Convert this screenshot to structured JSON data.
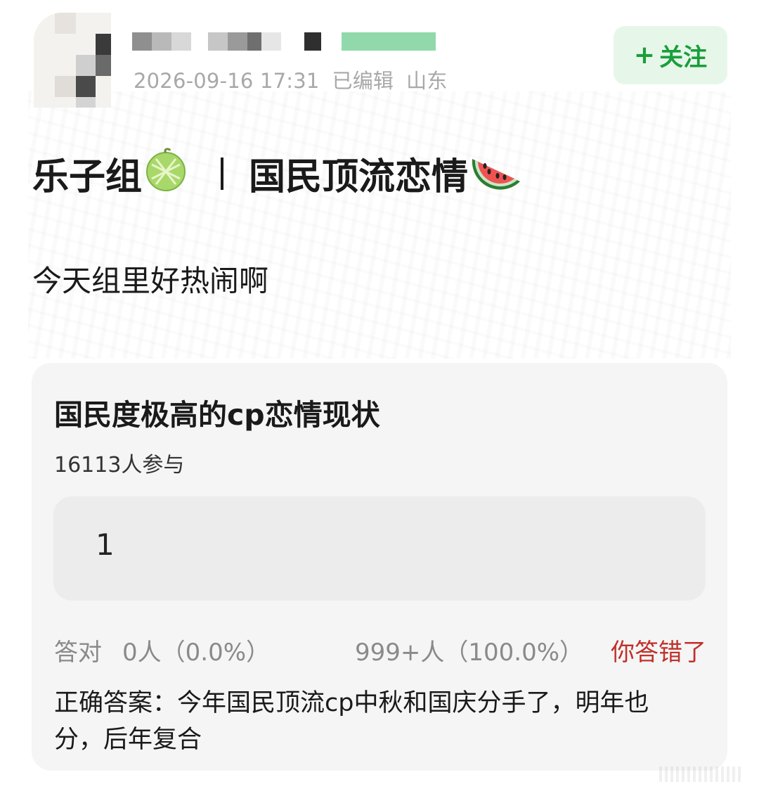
{
  "post": {
    "timestamp": "2026-09-16 17:31",
    "edited": "已编辑",
    "location": "山东",
    "follow_label": "关注",
    "follow_plus": "+",
    "title_left": "乐子组",
    "title_right": "国民顶流恋情",
    "body": "今天组里好热闹啊"
  },
  "quiz": {
    "title": "国民度极高的cp恋情现状",
    "participants": "16113人参与",
    "answer_value": "1",
    "correct_label": "答对",
    "correct_stats": "0人（0.0%）",
    "wrong_stats": "999+人（100.0%）",
    "wrong_message": "你答错了",
    "correct_answer": "正确答案：今年国民顶流cp中秋和国庆分手了，明年也分，后年复合"
  },
  "icons": {
    "title_left_icon": "melon-icon",
    "title_right_icon": "watermelon-icon"
  },
  "colors": {
    "accent_green": "#1a9e3b",
    "follow_bg": "#e6f7ea",
    "wrong_red": "#c0302b",
    "card_bg": "#f5f5f5"
  }
}
